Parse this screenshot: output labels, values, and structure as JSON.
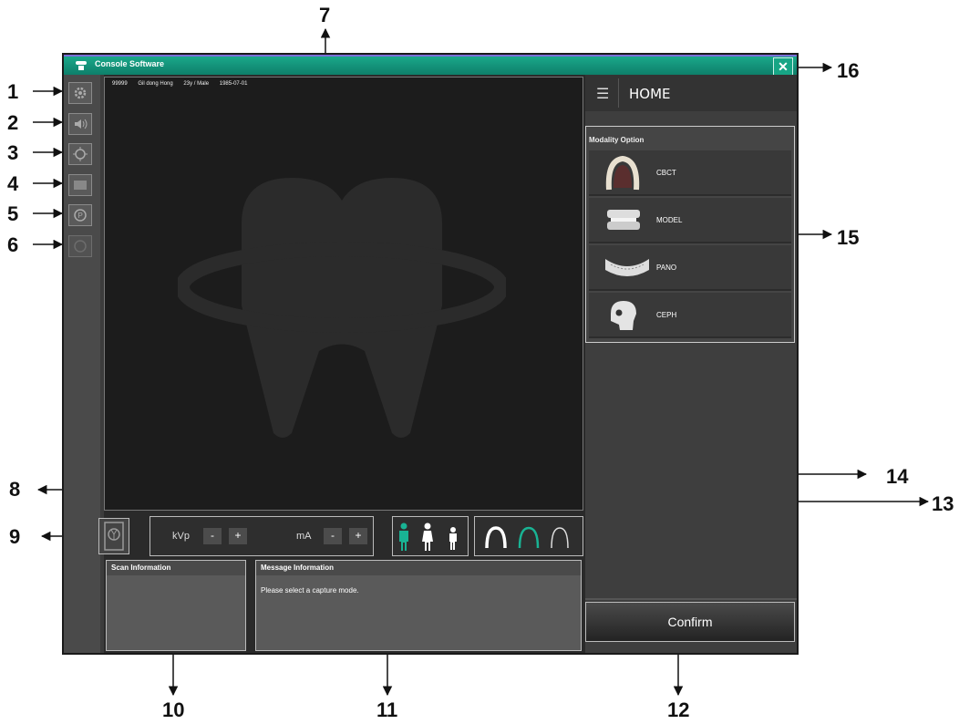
{
  "window": {
    "title": "Console Software",
    "close_label": "✕"
  },
  "patient": {
    "id": "99999",
    "name": "Gil dong Hong",
    "age_sex": "23y / Male",
    "dob": "1985-07-01"
  },
  "home": {
    "title": "HOME"
  },
  "modality": {
    "header": "Modality Option",
    "items": [
      {
        "label": "CBCT",
        "icon": "cbct-arch-icon"
      },
      {
        "label": "MODEL",
        "icon": "model-teeth-icon"
      },
      {
        "label": "PANO",
        "icon": "pano-jaw-icon"
      },
      {
        "label": "CEPH",
        "icon": "ceph-skull-icon"
      }
    ]
  },
  "controls": {
    "kvp_label": "kVp",
    "ma_label": "mA",
    "minus": "-",
    "plus": "+"
  },
  "scan_info": {
    "header": "Scan Information"
  },
  "message_info": {
    "header": "Message Information",
    "text": "Please select a capture mode."
  },
  "confirm_label": "Confirm",
  "callouts": [
    "1",
    "2",
    "3",
    "4",
    "5",
    "6",
    "7",
    "8",
    "9",
    "10",
    "11",
    "12",
    "13",
    "14",
    "15",
    "16"
  ],
  "colors": {
    "accent": "#1aa88a",
    "active_icon": "#19b394"
  }
}
